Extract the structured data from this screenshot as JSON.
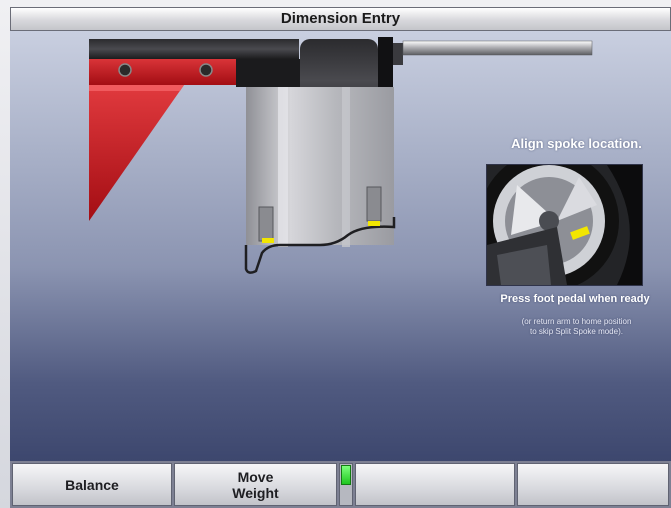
{
  "window": {
    "title": "Dimension Entry"
  },
  "instructions": {
    "align": "Align spoke location.",
    "press": "Press foot pedal when ready",
    "return": "(or return arm to home position\nto skip Split Spoke mode)."
  },
  "softkeys": [
    {
      "label": "Balance"
    },
    {
      "label": "Move\nWeight"
    },
    {
      "label": ""
    },
    {
      "label": ""
    }
  ],
  "status_indicator": {
    "state": "active",
    "color": "#2fdc2f"
  },
  "colors": {
    "mount_red": "#c8151b",
    "weight_yellow": "#f2e600",
    "background_top": "#c9cfe0",
    "background_bottom": "#3d476e"
  },
  "icons": [
    "spoke-location-photo",
    "balancer-shaft-graphic"
  ]
}
